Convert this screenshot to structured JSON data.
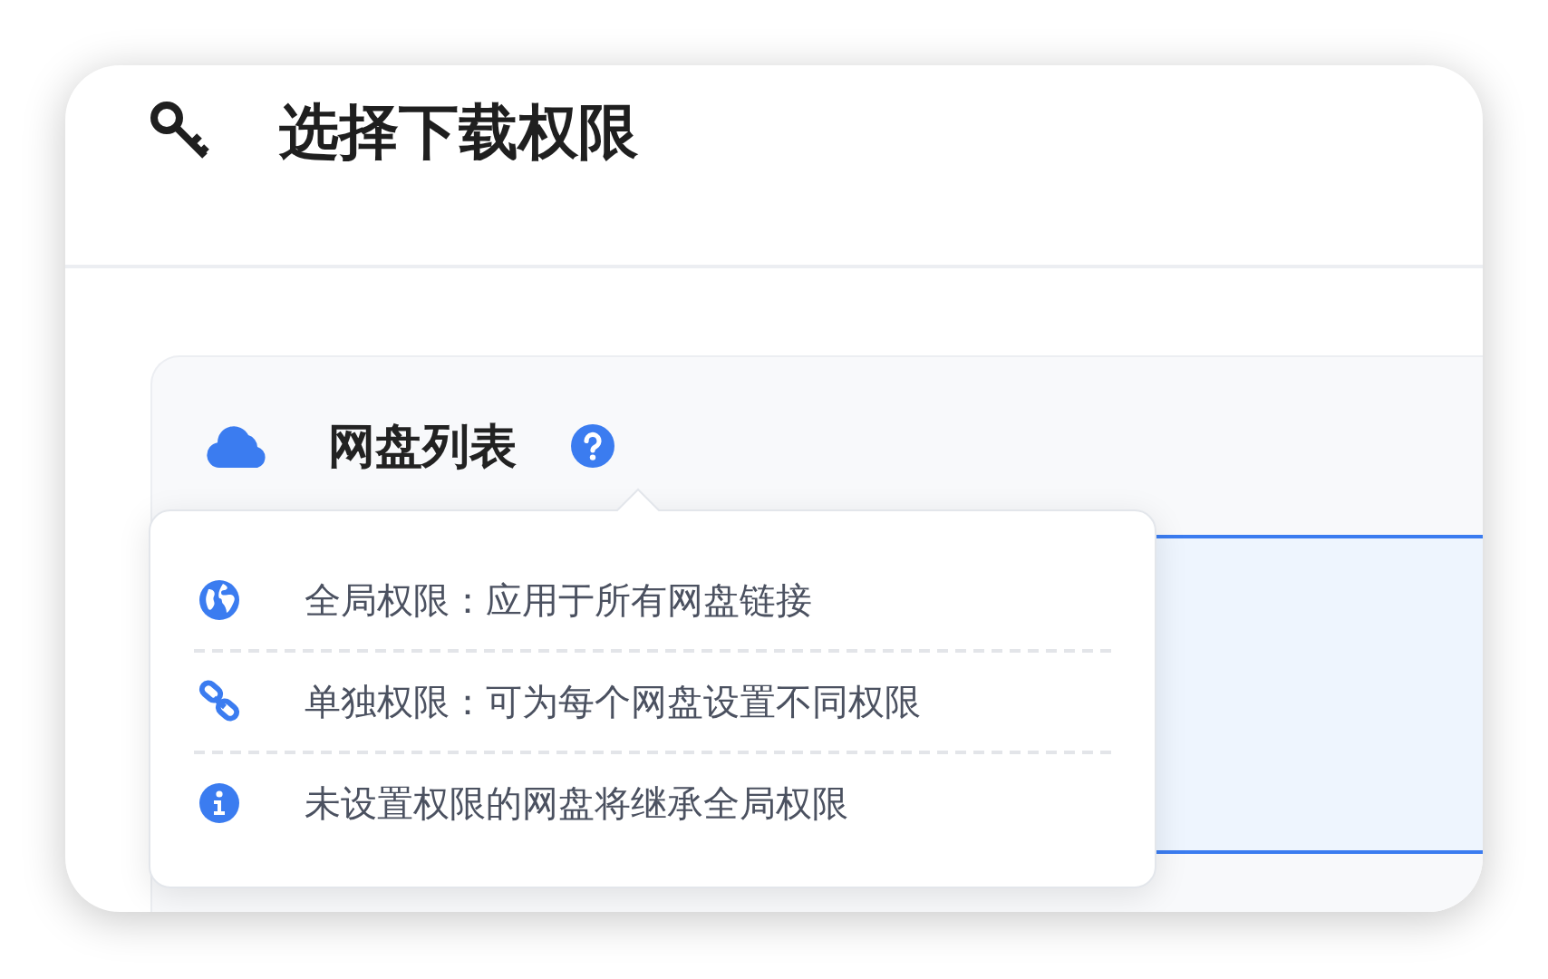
{
  "header": {
    "title": "选择下载权限"
  },
  "panel": {
    "title": "网盘列表"
  },
  "tooltip": {
    "items": [
      {
        "kind": "globe",
        "text": "全局权限：应用于所有网盘链接"
      },
      {
        "kind": "link",
        "text": "单独权限：可为每个网盘设置不同权限"
      },
      {
        "kind": "info",
        "text": "未设置权限的网盘将继承全局权限"
      }
    ]
  }
}
